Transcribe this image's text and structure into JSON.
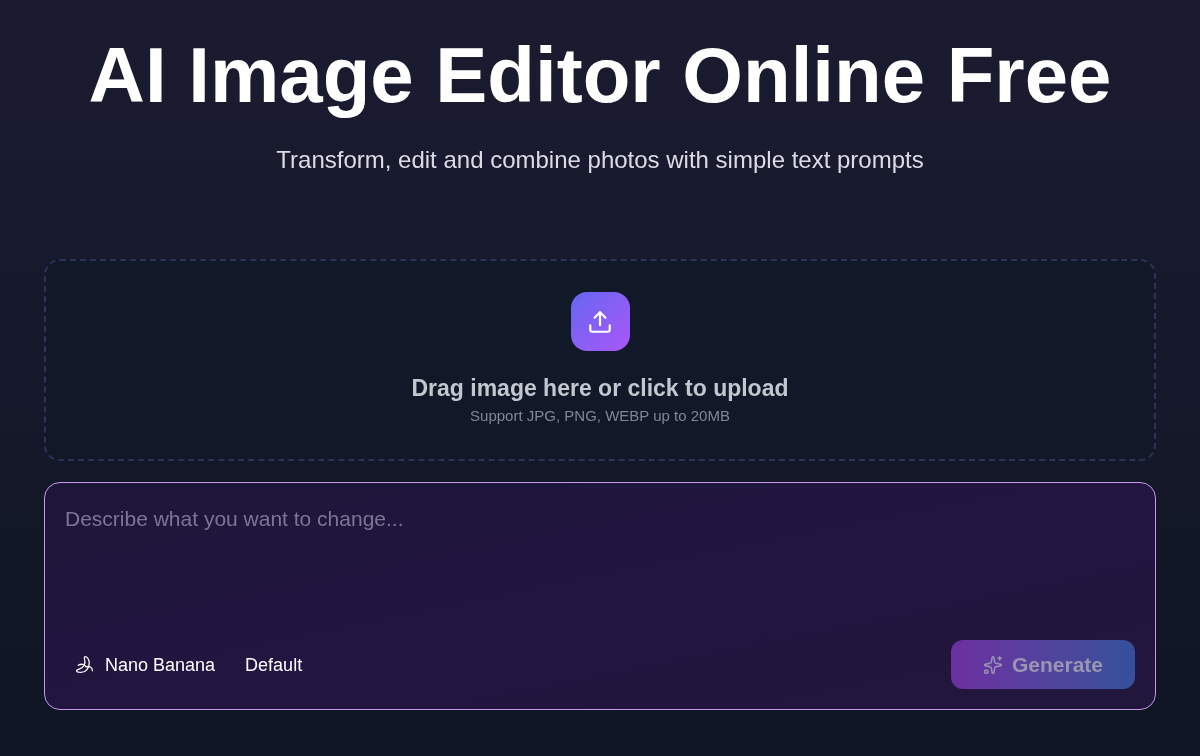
{
  "hero": {
    "title": "AI Image Editor Online Free",
    "subtitle": "Transform, edit and combine photos with simple text prompts"
  },
  "upload": {
    "label": "Drag image here or click to upload",
    "hint": "Support JPG, PNG, WEBP up to 20MB"
  },
  "prompt": {
    "placeholder": "Describe what you want to change...",
    "options": [
      {
        "kind": "model",
        "label": "Nano Banana"
      },
      {
        "kind": "style",
        "label": "Default"
      }
    ],
    "generate_button": {
      "label": "Generate",
      "disabled": true
    }
  }
}
